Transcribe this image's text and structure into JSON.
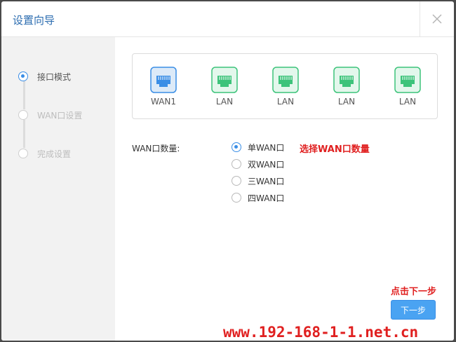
{
  "dialog": {
    "title": "设置向导"
  },
  "steps": [
    {
      "label": "接口模式",
      "active": true
    },
    {
      "label": "WAN口设置",
      "active": false
    },
    {
      "label": "完成设置",
      "active": false
    }
  ],
  "ports": [
    {
      "label": "WAN1",
      "type": "wan",
      "color": "#3a8ee6"
    },
    {
      "label": "LAN",
      "type": "lan",
      "color": "#3cc37a"
    },
    {
      "label": "LAN",
      "type": "lan",
      "color": "#3cc37a"
    },
    {
      "label": "LAN",
      "type": "lan",
      "color": "#3cc37a"
    },
    {
      "label": "LAN",
      "type": "lan",
      "color": "#3cc37a"
    }
  ],
  "wan_count": {
    "label": "WAN口数量:",
    "options": [
      {
        "label": "单WAN口",
        "checked": true
      },
      {
        "label": "双WAN口",
        "checked": false
      },
      {
        "label": "三WAN口",
        "checked": false
      },
      {
        "label": "四WAN口",
        "checked": false
      }
    ],
    "hint": "选择WAN口数量"
  },
  "next": {
    "hint": "点击下一步",
    "label": "下一步"
  },
  "watermark": "www.192-168-1-1.net.cn",
  "colors": {
    "accent": "#3a8ee6",
    "lan": "#3cc37a",
    "hint": "#e02020"
  }
}
